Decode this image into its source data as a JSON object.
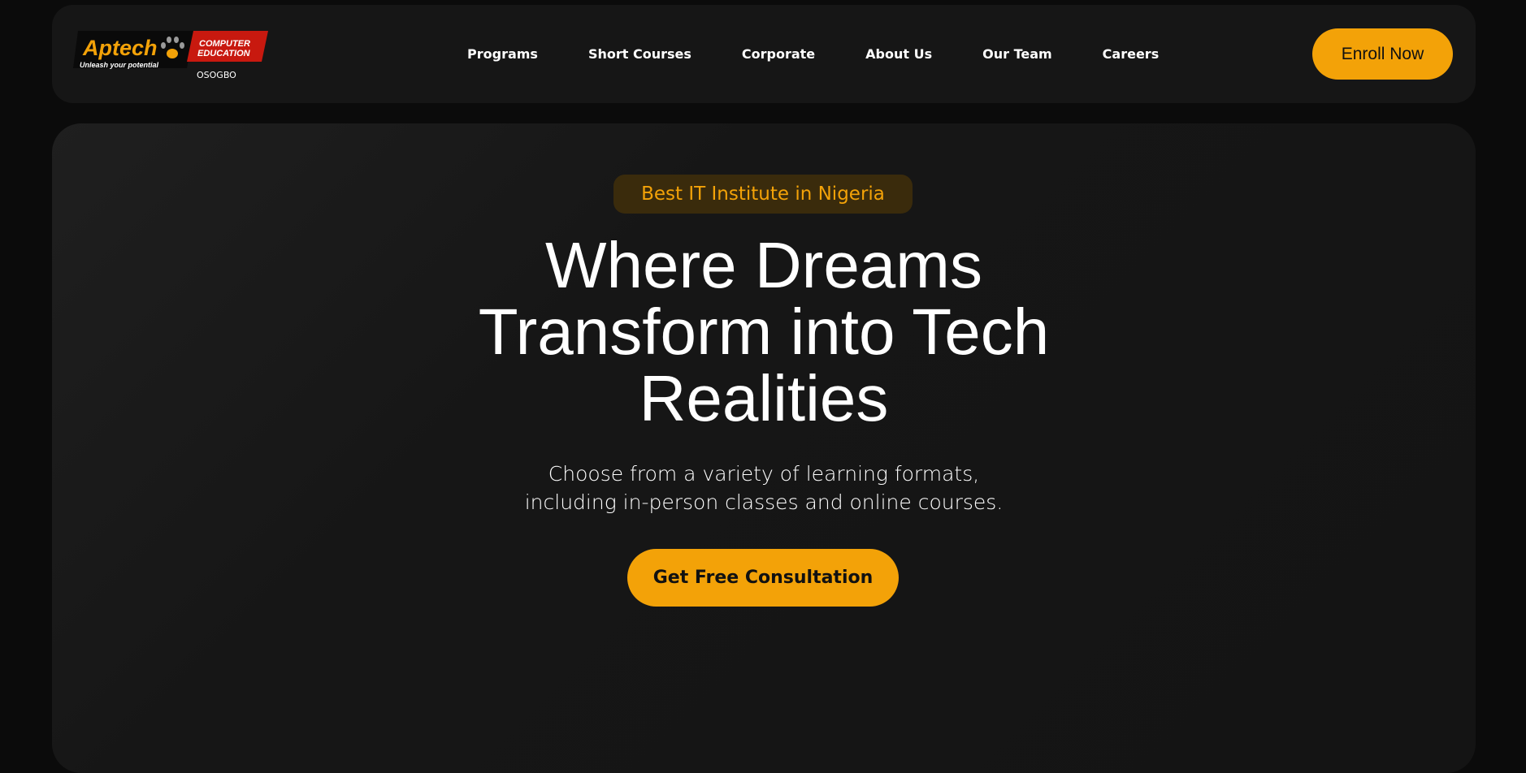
{
  "brand": {
    "name": "Aptech",
    "tagline": "Unleash your potential",
    "badge_line1": "COMPUTER",
    "badge_line2": "EDUCATION",
    "location": "OSOGBO"
  },
  "nav": {
    "items": [
      {
        "label": "Programs"
      },
      {
        "label": "Short Courses"
      },
      {
        "label": "Corporate"
      },
      {
        "label": "About Us"
      },
      {
        "label": "Our Team"
      },
      {
        "label": "Careers"
      }
    ],
    "enroll_label": "Enroll Now"
  },
  "hero": {
    "badge": "Best IT Institute in Nigeria",
    "title_line1": "Where Dreams",
    "title_line2": "Transform into Tech",
    "title_line3": "Realities",
    "subtitle_line1": "Choose from a variety of learning formats,",
    "subtitle_line2": "including in-person classes and online courses.",
    "cta_label": "Get Free Consultation"
  },
  "colors": {
    "accent": "#f3a208",
    "logo_red": "#c8190f",
    "background": "#0b0b0b",
    "panel": "#161616"
  },
  "icons": {
    "logo_mark": "paw-icon"
  }
}
